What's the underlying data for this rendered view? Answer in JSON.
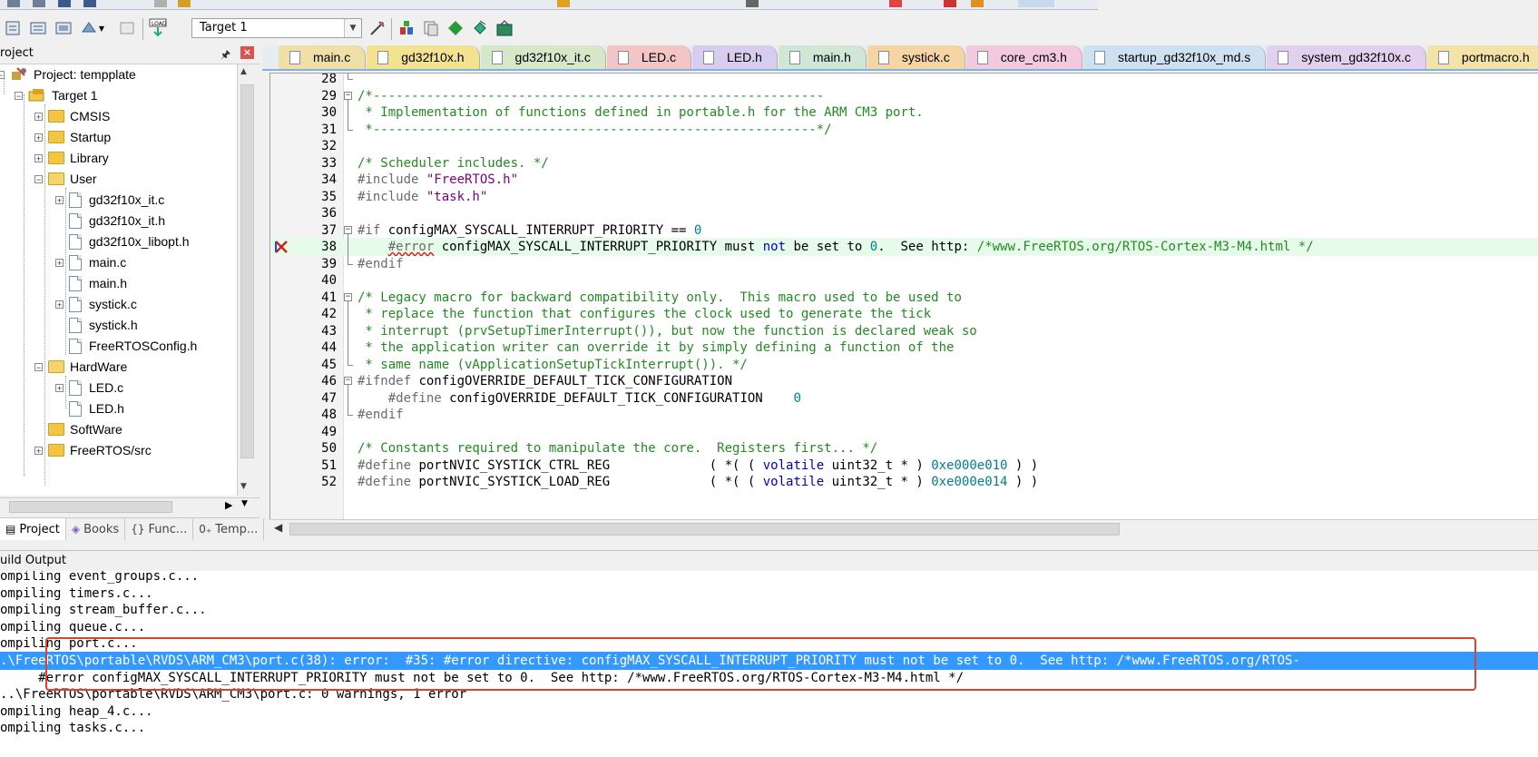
{
  "toolbar": {
    "target": "Target 1"
  },
  "project_panel": {
    "title": "roject",
    "tree": [
      {
        "label": "Project: tempplate",
        "kind": "root",
        "level": 0,
        "expander": "minus"
      },
      {
        "label": "Target 1",
        "kind": "target",
        "level": 1,
        "expander": "minus"
      },
      {
        "label": "CMSIS",
        "kind": "folder",
        "level": 2,
        "expander": "plus"
      },
      {
        "label": "Startup",
        "kind": "folder",
        "level": 2,
        "expander": "plus"
      },
      {
        "label": "Library",
        "kind": "folder",
        "level": 2,
        "expander": "plus"
      },
      {
        "label": "User",
        "kind": "folder-open",
        "level": 2,
        "expander": "minus"
      },
      {
        "label": "gd32f10x_it.c",
        "kind": "file",
        "level": 3,
        "expander": "plus"
      },
      {
        "label": "gd32f10x_it.h",
        "kind": "file",
        "level": 3,
        "expander": "none"
      },
      {
        "label": "gd32f10x_libopt.h",
        "kind": "file",
        "level": 3,
        "expander": "none"
      },
      {
        "label": "main.c",
        "kind": "file",
        "level": 3,
        "expander": "plus"
      },
      {
        "label": "main.h",
        "kind": "file",
        "level": 3,
        "expander": "none"
      },
      {
        "label": "systick.c",
        "kind": "file",
        "level": 3,
        "expander": "plus"
      },
      {
        "label": "systick.h",
        "kind": "file",
        "level": 3,
        "expander": "none"
      },
      {
        "label": "FreeRTOSConfig.h",
        "kind": "file",
        "level": 3,
        "expander": "none"
      },
      {
        "label": "HardWare",
        "kind": "folder-open",
        "level": 2,
        "expander": "minus"
      },
      {
        "label": "LED.c",
        "kind": "file",
        "level": 3,
        "expander": "plus"
      },
      {
        "label": "LED.h",
        "kind": "file",
        "level": 3,
        "expander": "none"
      },
      {
        "label": "SoftWare",
        "kind": "folder",
        "level": 2,
        "expander": "none"
      },
      {
        "label": "FreeRTOS/src",
        "kind": "folder",
        "level": 2,
        "expander": "plus"
      }
    ],
    "tabs": [
      {
        "label": "Project",
        "icon": "project-icon",
        "active": true
      },
      {
        "label": "Books",
        "icon": "books-icon",
        "active": false
      },
      {
        "label": "Func...",
        "icon": "braces-icon",
        "active": false
      },
      {
        "label": "Temp...",
        "icon": "template-icon",
        "active": false
      }
    ]
  },
  "editor": {
    "tabs": [
      {
        "label": "main.c",
        "color": "#f0e0a8"
      },
      {
        "label": "gd32f10x.h",
        "color": "#f3e28f"
      },
      {
        "label": "gd32f10x_it.c",
        "color": "#d6e8c8"
      },
      {
        "label": "LED.c",
        "color": "#f3c5c5"
      },
      {
        "label": "LED.h",
        "color": "#d8cdef"
      },
      {
        "label": "main.h",
        "color": "#cfe7d4"
      },
      {
        "label": "systick.c",
        "color": "#f5d5a3"
      },
      {
        "label": "core_cm3.h",
        "color": "#f3c9de"
      },
      {
        "label": "startup_gd32f10x_md.s",
        "color": "#cfe1f0"
      },
      {
        "label": "system_gd32f10x.c",
        "color": "#e3d0ee"
      },
      {
        "label": "portmacro.h",
        "color": "#f4e3a6"
      }
    ],
    "lines": [
      {
        "n": "28",
        "fold": "end",
        "segs": []
      },
      {
        "n": "29",
        "fold": "box",
        "segs": [
          {
            "c": "cm",
            "t": "/*-----------------------------------------------------------"
          }
        ]
      },
      {
        "n": "30",
        "fold": "bar",
        "segs": [
          {
            "c": "cm",
            "t": " * Implementation of functions defined in portable.h for the ARM CM3 port."
          }
        ]
      },
      {
        "n": "31",
        "fold": "end",
        "segs": [
          {
            "c": "cm",
            "t": " *----------------------------------------------------------*/"
          }
        ]
      },
      {
        "n": "32",
        "fold": "",
        "segs": []
      },
      {
        "n": "33",
        "fold": "",
        "segs": [
          {
            "c": "cm",
            "t": "/* Scheduler includes. */"
          }
        ]
      },
      {
        "n": "34",
        "fold": "",
        "segs": [
          {
            "c": "pp",
            "t": "#include "
          },
          {
            "c": "str",
            "t": "\"FreeRTOS.h\""
          }
        ]
      },
      {
        "n": "35",
        "fold": "",
        "segs": [
          {
            "c": "pp",
            "t": "#include "
          },
          {
            "c": "str",
            "t": "\"task.h\""
          }
        ]
      },
      {
        "n": "36",
        "fold": "",
        "segs": []
      },
      {
        "n": "37",
        "fold": "box",
        "segs": [
          {
            "c": "pp",
            "t": "#if "
          },
          {
            "c": "",
            "t": "configMAX_SYSCALL_INTERRUPT_PRIORITY == "
          },
          {
            "c": "num",
            "t": "0"
          }
        ]
      },
      {
        "n": "38",
        "fold": "bar",
        "hl": true,
        "err": true,
        "segs": [
          {
            "c": "",
            "t": "    "
          },
          {
            "c": "pp",
            "t": "#error"
          },
          {
            "c": "",
            "t": " configMAX_SYSCALL_INTERRUPT_PRIORITY must "
          },
          {
            "c": "kw",
            "t": "not"
          },
          {
            "c": "",
            "t": " be set to "
          },
          {
            "c": "num",
            "t": "0"
          },
          {
            "c": "",
            "t": ".  See http: "
          },
          {
            "c": "cm",
            "t": "/*www.FreeRTOS.org/RTOS-Cortex-M3-M4.html */"
          }
        ]
      },
      {
        "n": "39",
        "fold": "end",
        "segs": [
          {
            "c": "pp",
            "t": "#endif"
          }
        ]
      },
      {
        "n": "40",
        "fold": "",
        "segs": []
      },
      {
        "n": "41",
        "fold": "box",
        "segs": [
          {
            "c": "cm",
            "t": "/* Legacy macro for backward compatibility only.  This macro used to be used to"
          }
        ]
      },
      {
        "n": "42",
        "fold": "bar",
        "segs": [
          {
            "c": "cm",
            "t": " * replace the function that configures the clock used to generate the tick"
          }
        ]
      },
      {
        "n": "43",
        "fold": "bar",
        "segs": [
          {
            "c": "cm",
            "t": " * interrupt (prvSetupTimerInterrupt()), but now the function is declared weak so"
          }
        ]
      },
      {
        "n": "44",
        "fold": "bar",
        "segs": [
          {
            "c": "cm",
            "t": " * the application writer can override it by simply defining a function of the"
          }
        ]
      },
      {
        "n": "45",
        "fold": "end",
        "segs": [
          {
            "c": "cm",
            "t": " * same name (vApplicationSetupTickInterrupt()). */"
          }
        ]
      },
      {
        "n": "46",
        "fold": "box",
        "segs": [
          {
            "c": "pp",
            "t": "#ifndef "
          },
          {
            "c": "",
            "t": "configOVERRIDE_DEFAULT_TICK_CONFIGURATION"
          }
        ]
      },
      {
        "n": "47",
        "fold": "bar",
        "segs": [
          {
            "c": "",
            "t": "    "
          },
          {
            "c": "pp",
            "t": "#define "
          },
          {
            "c": "",
            "t": "configOVERRIDE_DEFAULT_TICK_CONFIGURATION    "
          },
          {
            "c": "num",
            "t": "0"
          }
        ]
      },
      {
        "n": "48",
        "fold": "end",
        "segs": [
          {
            "c": "pp",
            "t": "#endif"
          }
        ]
      },
      {
        "n": "49",
        "fold": "",
        "segs": []
      },
      {
        "n": "50",
        "fold": "",
        "segs": [
          {
            "c": "cm",
            "t": "/* Constants required to manipulate the core.  Registers first... */"
          }
        ]
      },
      {
        "n": "51",
        "fold": "",
        "segs": [
          {
            "c": "pp",
            "t": "#define "
          },
          {
            "c": "",
            "t": "portNVIC_SYSTICK_CTRL_REG             ( *( ( "
          },
          {
            "c": "kw",
            "t": "volatile"
          },
          {
            "c": "",
            "t": " uint32_t * ) "
          },
          {
            "c": "num",
            "t": "0xe000e010"
          },
          {
            "c": "",
            "t": " ) )"
          }
        ]
      },
      {
        "n": "52",
        "fold": "",
        "segs": [
          {
            "c": "pp",
            "t": "#define "
          },
          {
            "c": "",
            "t": "portNVIC_SYSTICK_LOAD_REG             ( *( ( "
          },
          {
            "c": "kw",
            "t": "volatile"
          },
          {
            "c": "",
            "t": " uint32_t * ) "
          },
          {
            "c": "num",
            "t": "0xe000e014"
          },
          {
            "c": "",
            "t": " ) )"
          }
        ]
      }
    ]
  },
  "build_output": {
    "title": "uild Output",
    "lines": [
      {
        "text": "ompiling event_groups.c...",
        "selected": false
      },
      {
        "text": "ompiling timers.c...",
        "selected": false
      },
      {
        "text": "ompiling stream_buffer.c...",
        "selected": false
      },
      {
        "text": "ompiling queue.c...",
        "selected": false
      },
      {
        "text": "ompiling port.c...",
        "selected": false
      },
      {
        "text": ".\\FreeRTOS\\portable\\RVDS\\ARM_CM3\\port.c(38): error:  #35: #error directive: configMAX_SYSCALL_INTERRUPT_PRIORITY must not be set to 0.  See http: /*www.FreeRTOS.org/RTOS-",
        "selected": true
      },
      {
        "text": "     #error configMAX_SYSCALL_INTERRUPT_PRIORITY must not be set to 0.  See http: /*www.FreeRTOS.org/RTOS-Cortex-M3-M4.html */",
        "selected": false
      },
      {
        "text": "..\\FreeRTOS\\portable\\RVDS\\ARM_CM3\\port.c: 0 warnings, 1 error",
        "selected": false
      },
      {
        "text": "ompiling heap_4.c...",
        "selected": false
      },
      {
        "text": "ompiling tasks.c...",
        "selected": false
      }
    ]
  },
  "colors": {
    "selection": "#3399ff",
    "error_box": "#d9432f",
    "comment": "#228b22",
    "string": "#800080",
    "number": "#00808b",
    "keyword": "#0000c8"
  }
}
